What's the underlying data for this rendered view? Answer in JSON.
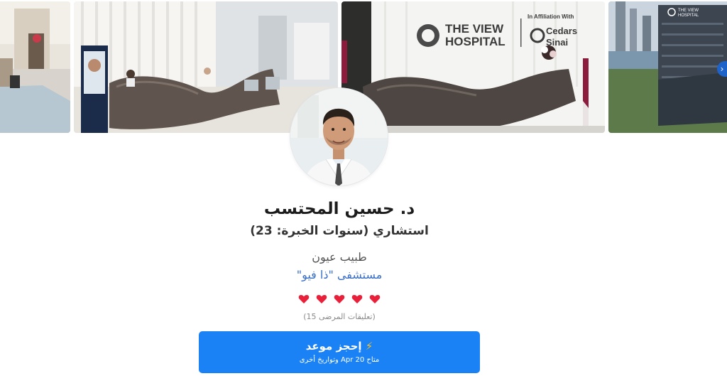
{
  "gallery": {
    "photos": [
      {
        "name": "lobby-lounge-photo"
      },
      {
        "name": "reception-desk-photo"
      },
      {
        "name": "hospital-entrance-photo"
      },
      {
        "name": "building-exterior-photo"
      }
    ],
    "sign_main": "THE VIEW\nHOSPITAL",
    "sign_affiliation": "In Affiliation With",
    "sign_partner": "Cedars\nSinai",
    "next_icon": "chevron-right-icon"
  },
  "doctor": {
    "name": "د. حسين المحتسب",
    "title": "استشاري (سنوات الخبرة: 23)",
    "specialty": "طبيب عيون",
    "hospital": "مستشفى \"ذا فيو\"",
    "rating": 5,
    "reviews": "(15 تعليقات المرضى)"
  },
  "booking": {
    "label": "إحجز موعد",
    "icon": "lightning-icon",
    "availability": "متاح Apr 20 وتواريخ أخرى"
  },
  "colors": {
    "accent": "#1a82f5",
    "link": "#3a6fc8",
    "heart": "#e8203a",
    "bolt": "#ffc21a"
  }
}
